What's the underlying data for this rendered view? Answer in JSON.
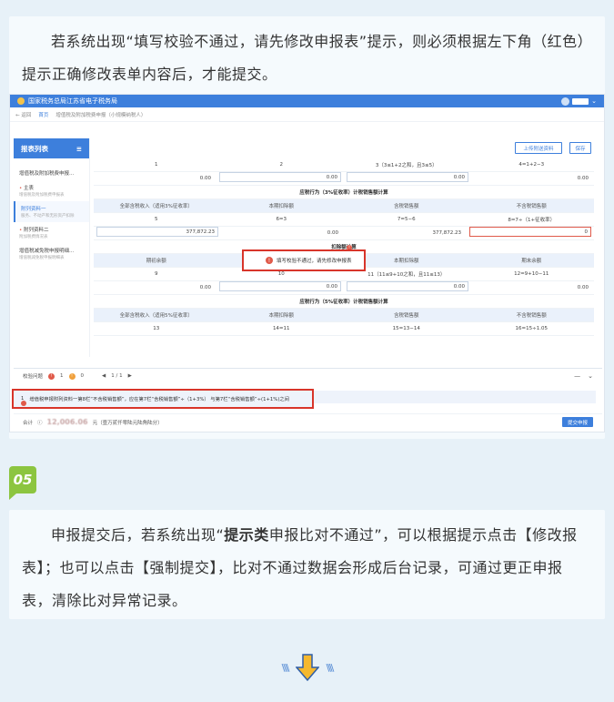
{
  "intro": {
    "text": "若系统出现“填写校验不通过，请先修改申报表”提示，则必须根据左下角（红色）提示正确修改表单内容后，才能提交。"
  },
  "shot": {
    "portal_title": "国家税务总局江苏省电子税务局",
    "back": "返回",
    "breadcrumb_home": "首页",
    "breadcrumb_page": "增值税及附加税费申报（小规模纳税人）",
    "sidebar_title": "报表列表",
    "sidebar_items": [
      {
        "label": "增值税及附加税费申报...",
        "sub": ""
      },
      {
        "label": "主表",
        "sub": "增值税及附加税费申报表"
      },
      {
        "label": "附列资料一",
        "sub": "服务、不动产和无形资产扣除"
      },
      {
        "label": "附列资料二",
        "sub": "附加税费情况表"
      },
      {
        "label": "增值税减免税申报明细...",
        "sub": "增值税减免税申报明细表"
      }
    ],
    "upload_button": "上传附送资料",
    "save_button": "保存",
    "rows": {
      "r1": [
        "1",
        "2",
        "3（3≤1+2之和，且3≤5）",
        "4=1+2−3"
      ],
      "r2": [
        "0.00",
        "0.00",
        "0.00",
        "0.00"
      ],
      "section1": "应税行为（3%征收率）计税销售额计算",
      "head1": [
        "全部含税收入（适用3%征收率）",
        "本期扣除额",
        "含税销售额",
        "不含税销售额"
      ],
      "r3": [
        "5",
        "6=3",
        "7=5−6",
        "8=7÷（1+征收率）"
      ],
      "r4": [
        "377,872.23",
        "0.00",
        "377,872.23",
        "0"
      ],
      "section2": "扣除额计算",
      "head2": [
        "期初余额",
        "本期发生额",
        "本期扣除额",
        "期末余额"
      ],
      "r5": [
        "9",
        "10",
        "11（11≤9+10之和，且11≤13）",
        "12=9+10−11"
      ],
      "r6": [
        "0.00",
        "0.00",
        "0.00",
        "0.00"
      ],
      "section3": "应税行为（5%征收率）计税销售额计算",
      "head3": [
        "全部含税收入（适用5%征收率）",
        "本期扣除额",
        "含税销售额",
        "不含税销售额"
      ],
      "r7": [
        "13",
        "14=11",
        "15=13−14",
        "16=15÷1.05"
      ]
    },
    "popup": "填写校验不通过，请先修改申报表",
    "validation_label": "校验问题",
    "err_count": "1",
    "warn_count": "0",
    "pager": "1 / 1",
    "error_num": "1",
    "error_msg": "增值税申报附列资料一第8栏“不含税销售额”，应在第7栏“含税销售额”÷（1+3%） 与第7栏“含税销售额”÷(1+1%)之间",
    "total_label": "合计",
    "total_amount": "12,006.06",
    "total_unit": "元（壹万贰仟零陆元陆角陆分）",
    "submit_button": "提交申报"
  },
  "step_badge": "05",
  "outro": {
    "text_before": "申报提交后，若系统出现“",
    "text_bold": "提示类",
    "text_after": "申报比对不通过”，可以根据提示点击【修改报表】；也可以点击【强制提交】，比对不通过数据会形成后台记录，可通过更正申报表，清除比对异常记录。"
  }
}
